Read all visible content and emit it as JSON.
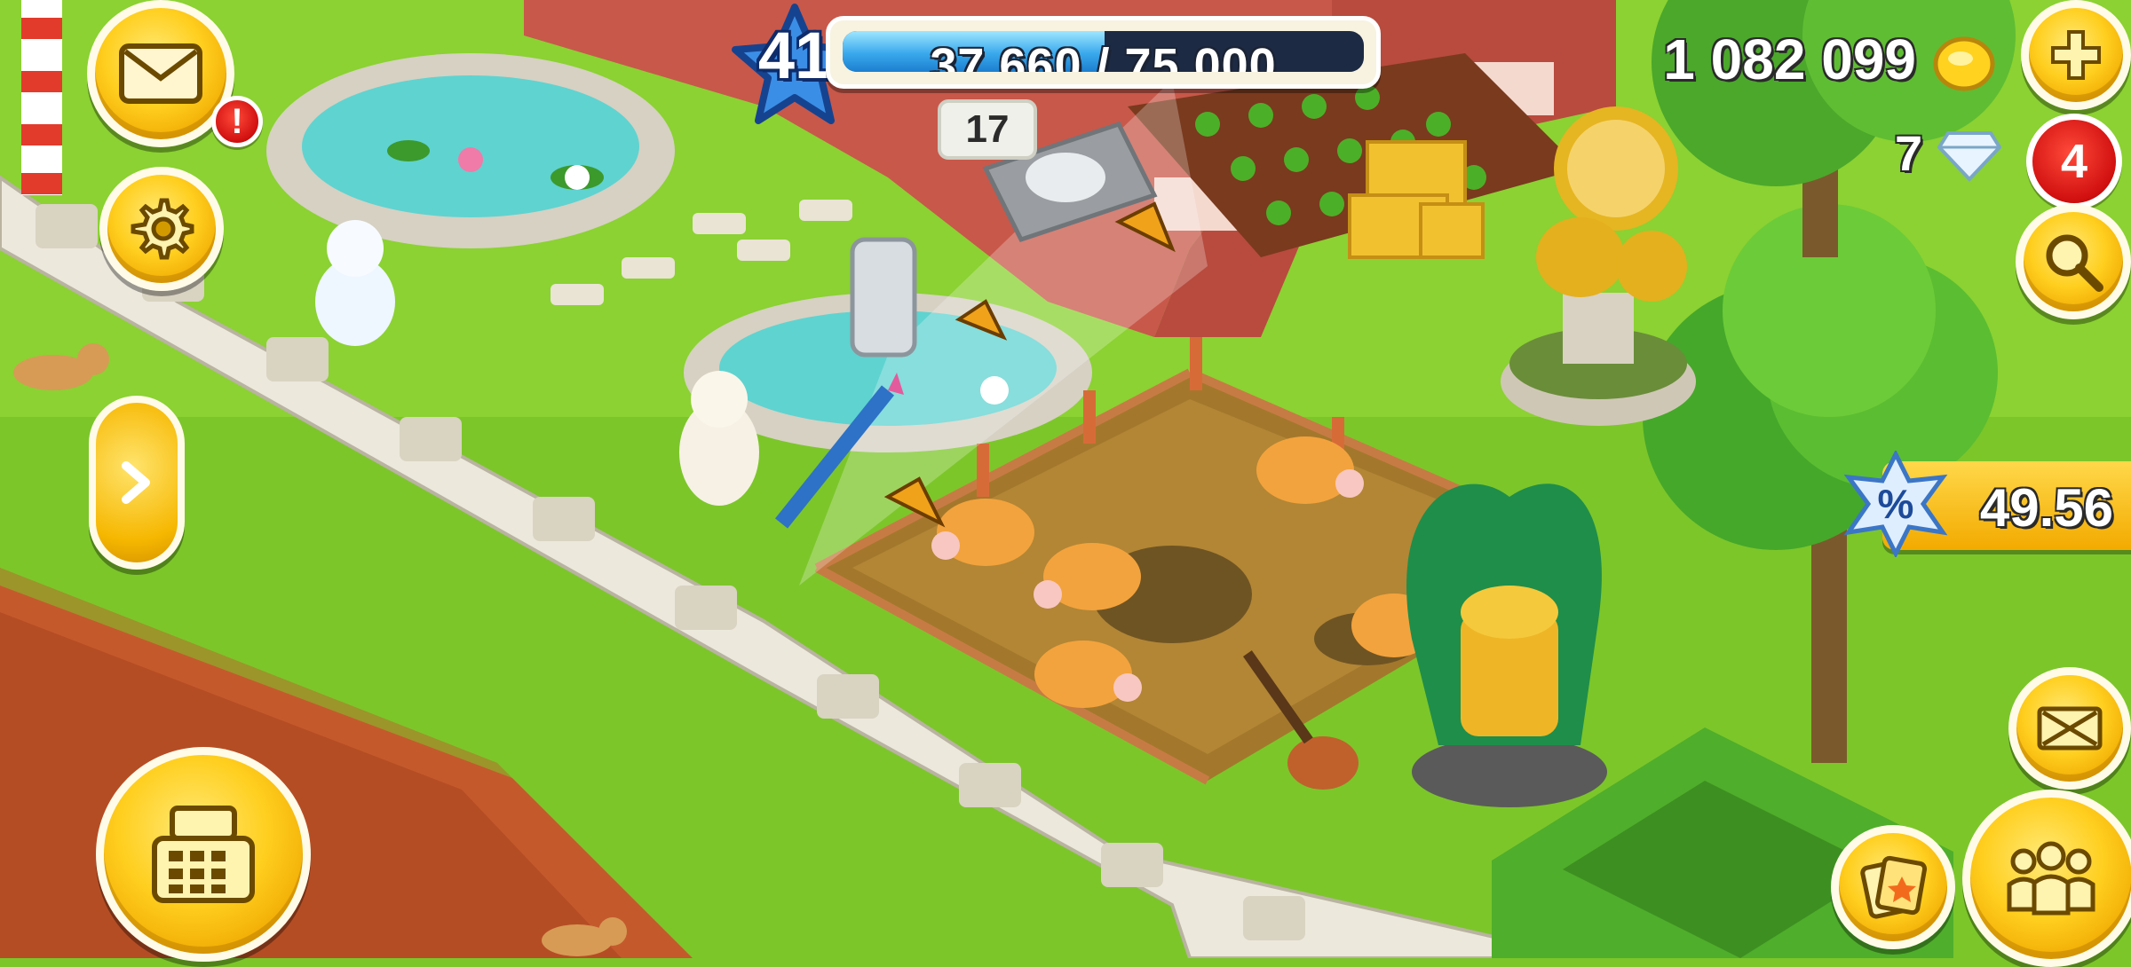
{
  "hud": {
    "level": "41",
    "xp_text": "37 660 / 75 000",
    "xp_progress": 0.502,
    "coins": "1 082 099",
    "diamonds": "7",
    "notification_count": "4",
    "mail_alert": "!",
    "discount_value": "49.56",
    "pen_count": "17"
  },
  "icons": {
    "mail": "mail-icon",
    "settings": "gear-icon",
    "expand": "chevron-right-icon",
    "shop": "cash-register-icon",
    "add_coins": "plus-icon",
    "search": "magnifier-icon",
    "edit_mode": "resize-arrows-icon",
    "friends": "friends-icon",
    "cards": "cards-icon",
    "coin": "coin-icon",
    "diamond": "diamond-icon"
  },
  "colors": {
    "grass": "#7cc62a",
    "path": "#c45a2c",
    "gold_button": "#ffcf1f",
    "xp_blue": "#3aa9ec"
  }
}
